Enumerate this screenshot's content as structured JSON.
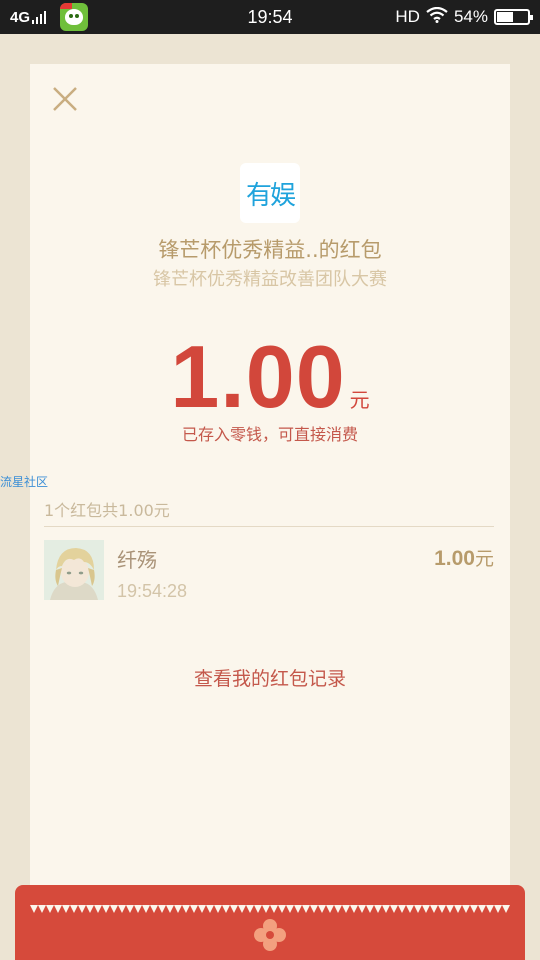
{
  "status_bar": {
    "network": "4G",
    "time": "19:54",
    "hd": "HD",
    "battery_percent": "54%",
    "battery_level": 0.54
  },
  "logo": {
    "text": "有娱",
    "color": "#1fa3dc"
  },
  "envelope": {
    "sender_name": "锋芒杯优秀精益..的红包",
    "greeting": "锋芒杯优秀精益改善团队大赛",
    "amount": "1.00",
    "amount_unit": "元",
    "amount_note": "已存入零钱，可直接消费"
  },
  "watermark": "流星社区",
  "records": {
    "summary": "1个红包共1.00元",
    "items": [
      {
        "name": "纤殇",
        "time": "19:54:28",
        "amount": "1.00",
        "unit": "元"
      }
    ]
  },
  "history_link": "查看我的红包记录",
  "colors": {
    "accent_red": "#d2473b",
    "gold_text": "#b79b6b",
    "card_bg": "#fbf6ec",
    "page_bg": "#ece4d3"
  }
}
